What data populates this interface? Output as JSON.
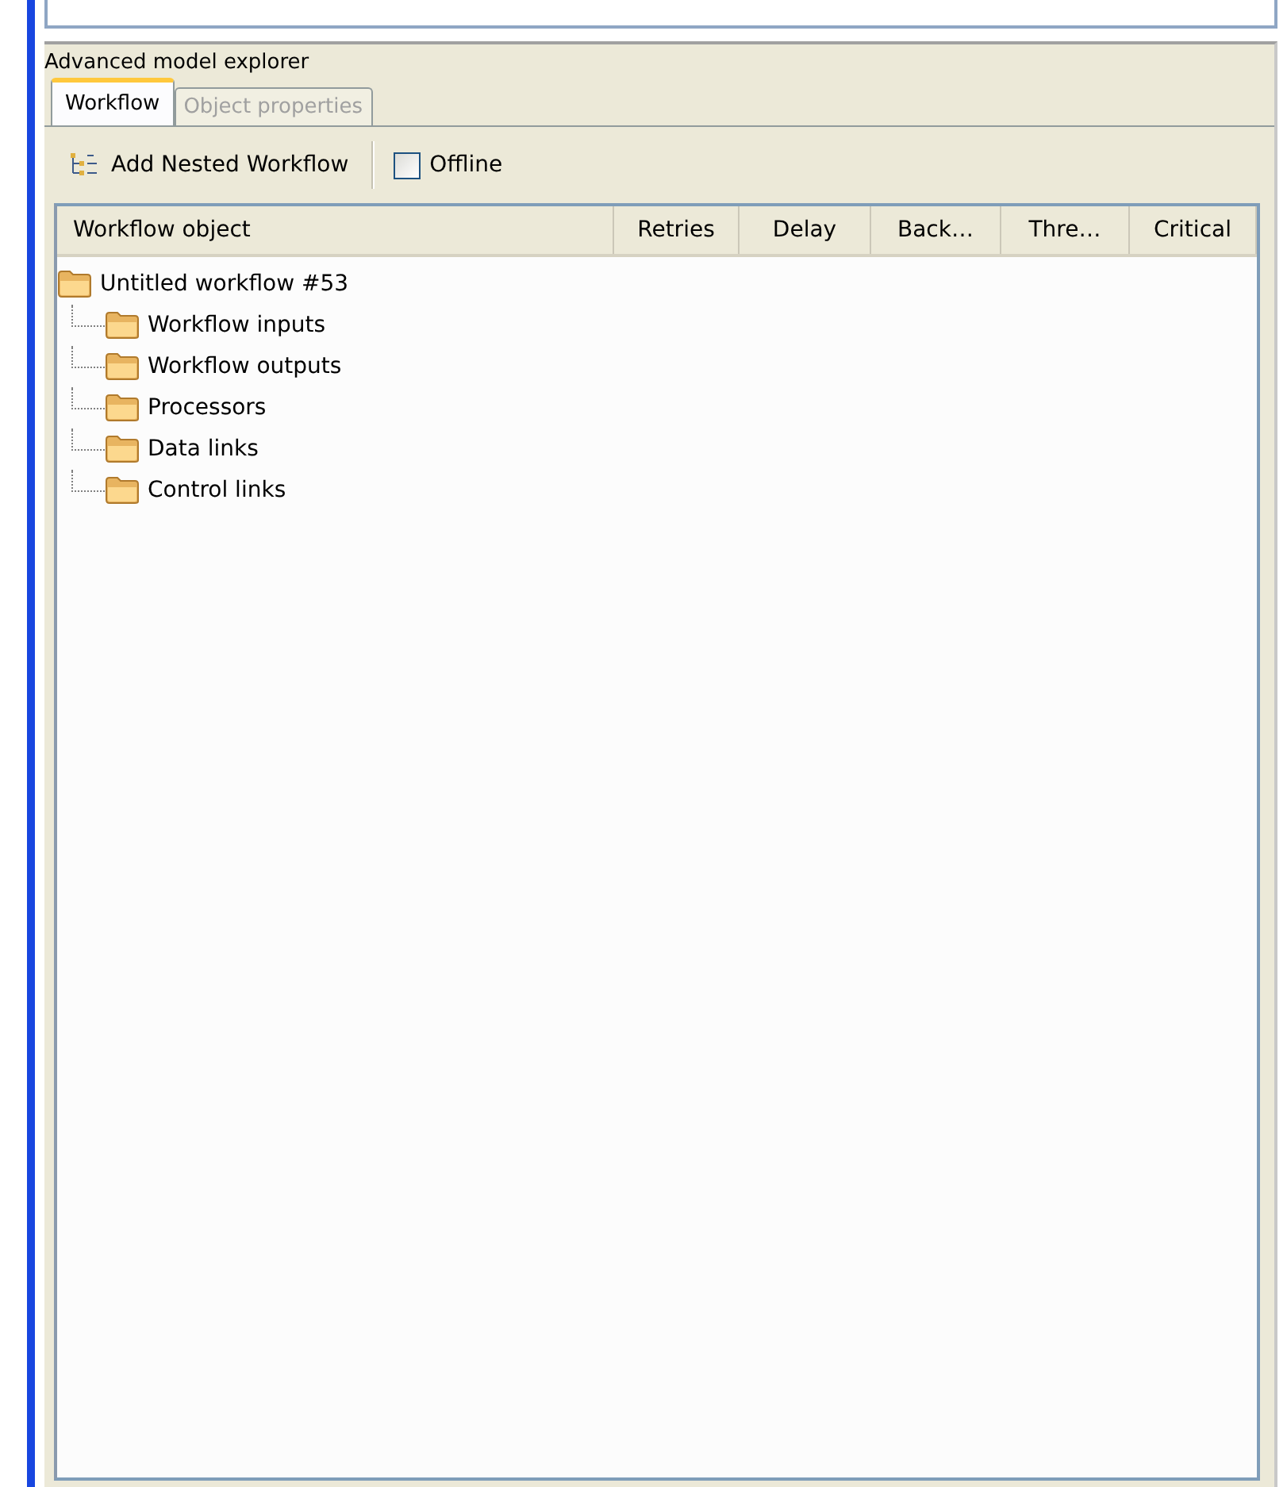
{
  "panel": {
    "title": "Advanced model explorer"
  },
  "tabs": [
    {
      "label": "Workflow",
      "selected": true
    },
    {
      "label": "Object properties",
      "selected": false
    }
  ],
  "toolbar": {
    "add_button": "Add Nested Workflow",
    "offline": {
      "label": "Offline",
      "checked": false
    }
  },
  "table": {
    "columns": [
      "Workflow object",
      "Retries",
      "Delay",
      "Back…",
      "Thre…",
      "Critical"
    ],
    "tree": [
      {
        "label": "Untitled workflow #53",
        "children": [
          {
            "label": "Workflow inputs"
          },
          {
            "label": "Workflow outputs"
          },
          {
            "label": "Processors"
          },
          {
            "label": "Data links"
          },
          {
            "label": "Control links"
          }
        ]
      }
    ]
  }
}
